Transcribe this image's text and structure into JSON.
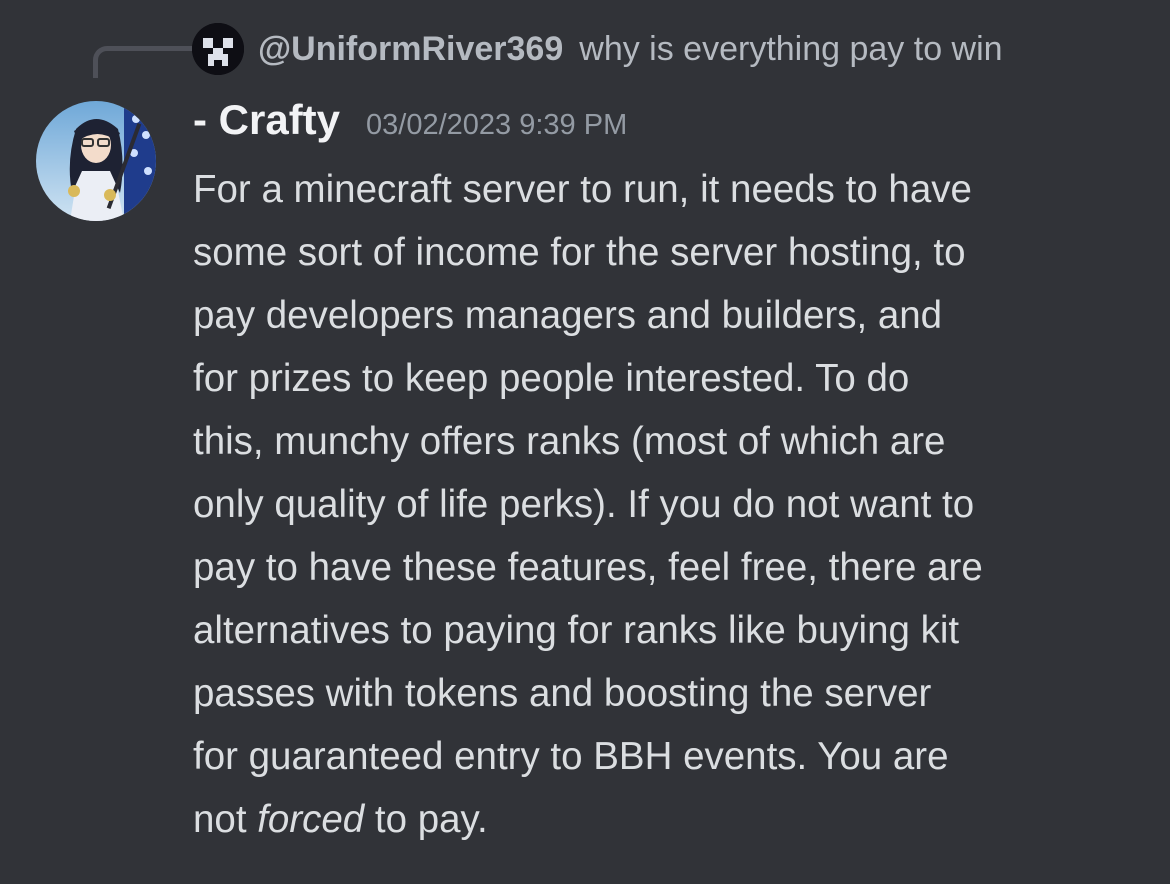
{
  "reply": {
    "author": "@UniformRiver369",
    "content": "why is everything pay to win",
    "avatar_icon": "creeper-face-icon"
  },
  "message": {
    "author": "- Crafty",
    "timestamp": "03/02/2023 9:39 PM",
    "avatar": "anime-character-avatar",
    "lines": [
      "For a minecraft server to run, it needs to have",
      "some sort of income for the server hosting, to",
      "pay developers managers and builders, and",
      "for prizes to keep people interested. To do",
      "this, munchy offers ranks (most of which are",
      "only quality of life perks). If you do not want to",
      "pay to have these features, feel free, there are",
      "alternatives to paying for ranks like buying kit",
      "passes with tokens and boosting the server",
      "for guaranteed entry to BBH events. You are"
    ],
    "last_line": {
      "before": "not ",
      "emphasis": "forced",
      "after": " to pay."
    }
  },
  "colors": {
    "background": "#313338",
    "text": "#dbdee1",
    "author": "#f2f3f5",
    "muted": "#949ba4"
  }
}
